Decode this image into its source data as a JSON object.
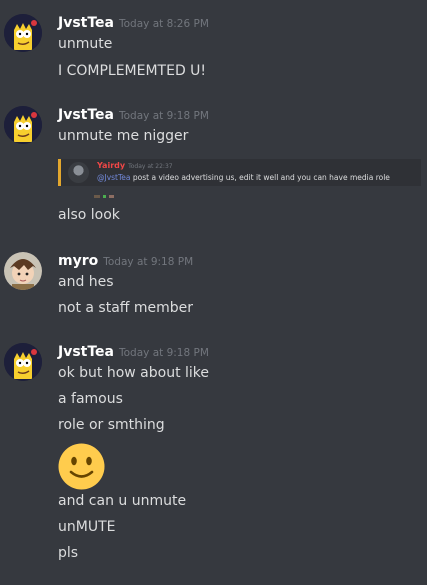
{
  "messages": [
    {
      "author": "JvstTea",
      "timestamp": "Today at 8:26 PM",
      "avatar": "bart-simpson-avatar",
      "lines": [
        "unmute",
        "I COMPLEMEMTED U!"
      ]
    },
    {
      "author": "JvstTea",
      "timestamp": "Today at 9:18 PM",
      "avatar": "bart-simpson-avatar",
      "lines": [
        "unmute me nigger"
      ],
      "embed": {
        "author": "Yairdy",
        "timestamp": "Today at 22:37",
        "mention": "@JvstTea",
        "text": " post a video advertising us, edit it well and you can have media role",
        "accent": "#e3a72e"
      },
      "after_embed": [
        "also look"
      ]
    },
    {
      "author": "myro",
      "timestamp": "Today at 9:18 PM",
      "avatar": "anime-character-avatar",
      "lines": [
        "and hes",
        "not a staff member"
      ]
    },
    {
      "author": "JvstTea",
      "timestamp": "Today at 9:18 PM",
      "avatar": "bart-simpson-avatar",
      "lines": [
        "ok but how about like",
        "a famous",
        "role or smthing"
      ],
      "emoji": "slightly-smiling-face",
      "after_emoji": [
        "and can u unmute",
        "unMUTE",
        "pls"
      ]
    }
  ],
  "colors": {
    "background": "#36393f",
    "embed_background": "#2f3136",
    "mention": "#7289da",
    "embed_author": "#f04747"
  }
}
